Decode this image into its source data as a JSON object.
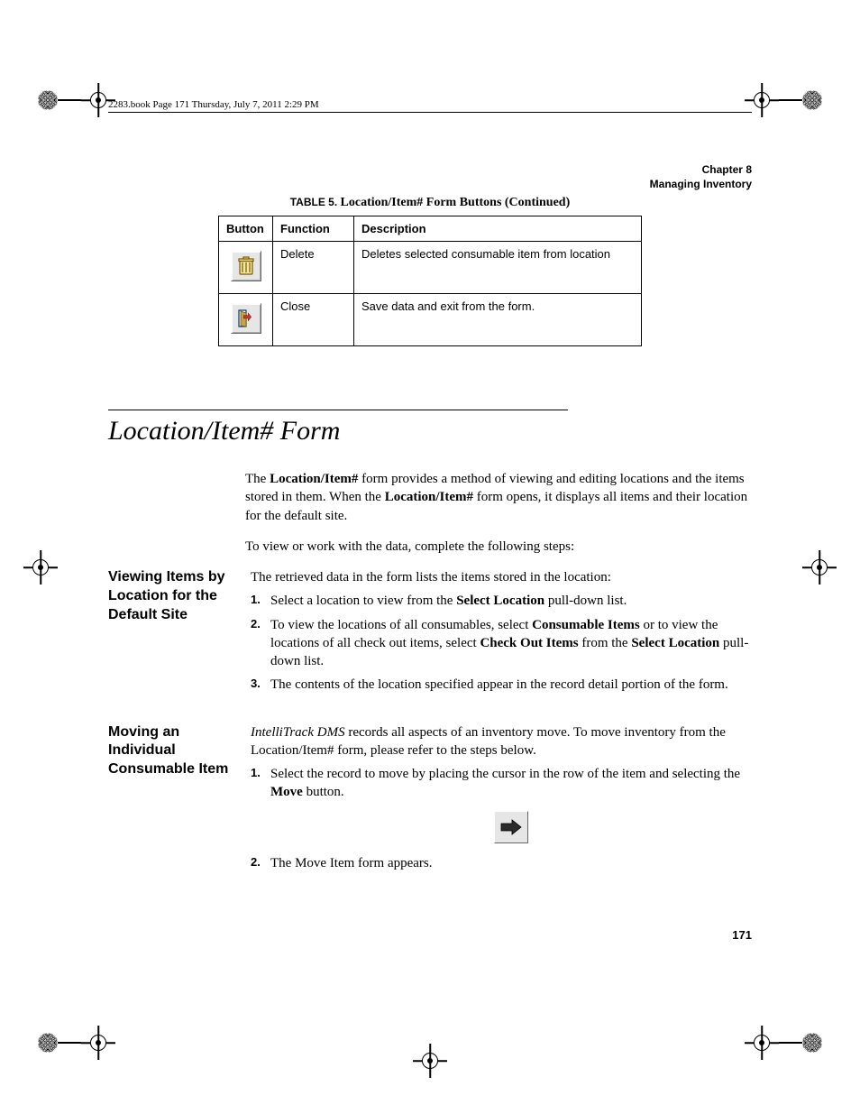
{
  "running_header": "2283.book  Page 171  Thursday, July 7, 2011  2:29 PM",
  "chapter": "Chapter 8",
  "section_top": "Managing Inventory",
  "table_caption_prefix": "TABLE 5. ",
  "table_caption_title": "Location/Item# Form Buttons (Continued)",
  "table": {
    "headers": [
      "Button",
      "Function",
      "Description"
    ],
    "rows": [
      {
        "function": "Delete",
        "description": "Deletes selected consumable item from location",
        "icon": "trash-icon"
      },
      {
        "function": "Close",
        "description": "Save data and exit from the form.",
        "icon": "door-exit-icon"
      }
    ]
  },
  "section_title": "Location/Item# Form",
  "intro_p1_a": "The ",
  "intro_p1_b": "Location/Item#",
  "intro_p1_c": " form provides a method of viewing and editing locations and the items stored in them. When the ",
  "intro_p1_d": "Location/Item#",
  "intro_p1_e": " form opens, it displays all items and their location for the default site.",
  "intro_p2": "To view or work with the data, complete the following steps:",
  "viewing": {
    "heading": "Viewing Items by Location for the Default Site",
    "lead": "The retrieved data in the form lists the items stored in the location:",
    "step1_a": "Select a location to view from the ",
    "step1_b": "Select Location",
    "step1_c": " pull-down list.",
    "step2_a": "To view the locations of all consumables, select ",
    "step2_b": "Consumable Items",
    "step2_c": " or to view the locations of all check out items, select ",
    "step2_d": "Check Out Items",
    "step2_e": " from the ",
    "step2_f": "Select Location",
    "step2_g": " pull-down list.",
    "step3": "The contents of the location specified appear in the record detail portion of the form."
  },
  "moving": {
    "heading": "Moving an Individual Consumable Item",
    "lead_a": "IntelliTrack DMS",
    "lead_b": " records all aspects of an inventory move. To move inventory from the Location/Item# form, please refer to the steps below.",
    "step1_a": "Select the record to move by placing the cursor in the row of the item and selecting the ",
    "step1_b": "Move",
    "step1_c": " button.",
    "step2": "The Move Item form appears."
  },
  "page_number": "171"
}
